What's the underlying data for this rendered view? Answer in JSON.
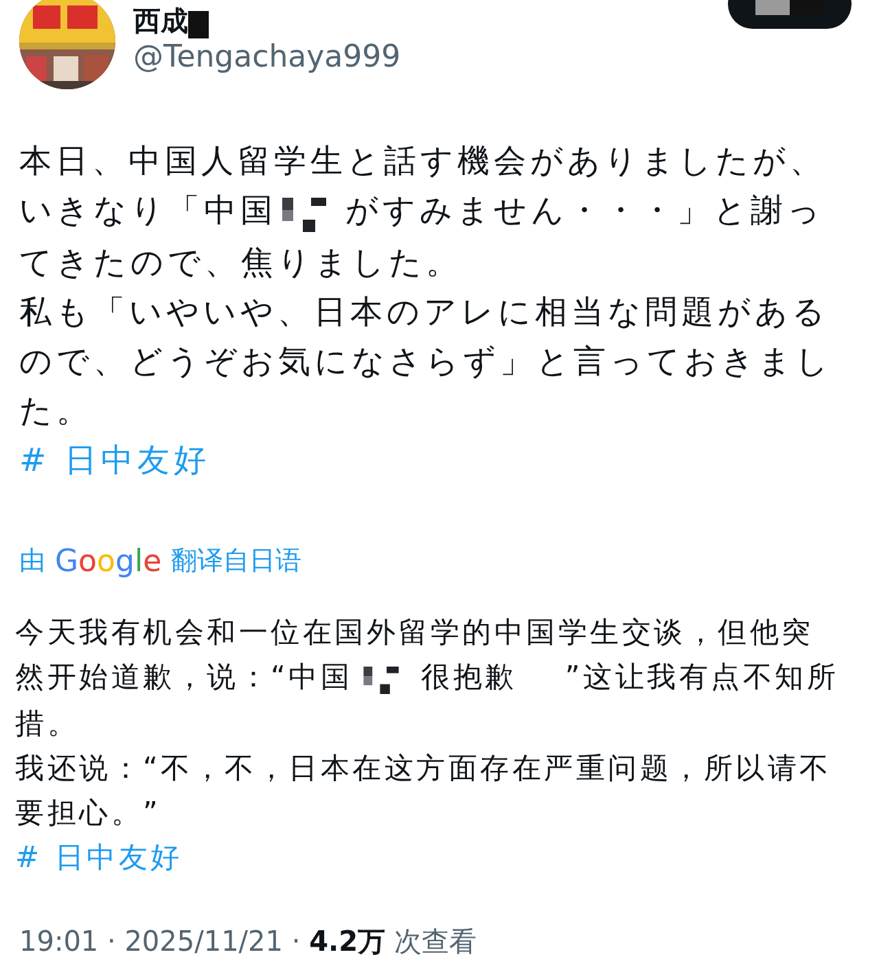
{
  "author": {
    "name": [
      {
        "text": "西成"
      },
      {
        "kind": "redaction"
      }
    ],
    "handle": "@Tengachaya999"
  },
  "follow_button": {
    "kind": "redaction"
  },
  "original": {
    "lines": [
      [
        {
          "text": "本日、中国人留学生と話す機会がありましたが、"
        }
      ],
      [
        {
          "text": "いきなり「中国"
        },
        {
          "kind": "redaction"
        },
        {
          "text": "がすみません・・・」と謝っ"
        }
      ],
      [
        {
          "text": "てきたので、焦りました。"
        }
      ],
      [
        {
          "text": "私も「いやいや、日本のアレに相当な問題がある"
        }
      ],
      [
        {
          "text": "ので、どうぞお気になさらず」と言っておきまし"
        }
      ],
      [
        {
          "text": "た。"
        }
      ]
    ],
    "hashtag": "# 日中友好"
  },
  "translation_label": {
    "prefix": "由",
    "brand": "Google",
    "suffix": "翻译自日语"
  },
  "translation": {
    "lines": [
      [
        {
          "text": "今天我有机会和一位在国外留学的中国学生交谈，但他突"
        }
      ],
      [
        {
          "text": "然开始道歉，说：“中国"
        },
        {
          "kind": "redaction"
        },
        {
          "text": "很抱歉"
        },
        {
          "kind": "blank"
        },
        {
          "text": "”这让我有点不知所"
        }
      ],
      [
        {
          "text": "措。"
        }
      ],
      [
        {
          "text": "我还说：“不，不，日本在这方面存在严重问题，所以请不"
        }
      ],
      [
        {
          "text": "要担心。”"
        }
      ]
    ],
    "hashtag": "# 日中友好"
  },
  "meta": {
    "time": "19:01 · 2025/11/21 ·",
    "views": "4.2万",
    "views_label": "次查看"
  }
}
